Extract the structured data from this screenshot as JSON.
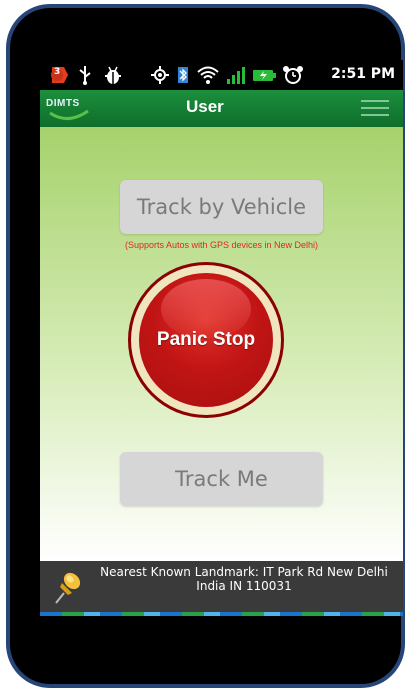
{
  "statusbar": {
    "time": "2:51 PM",
    "notification_count": "3",
    "icons": [
      "notification-badge-icon",
      "usb-icon",
      "android-debug-icon",
      "gps-icon",
      "bluetooth-icon",
      "wifi-icon",
      "signal-icon",
      "battery-icon",
      "alarm-icon"
    ]
  },
  "actionbar": {
    "logo": "DIMTS",
    "title": "User"
  },
  "main": {
    "track_vehicle_label": "Track by Vehicle",
    "support_note": "(Supports Autos with GPS devices in New Delhi)",
    "panic_label": "Panic Stop",
    "track_me_label": "Track Me"
  },
  "landmark": {
    "text": "Nearest Known Landmark: IT Park Rd New Delhi India IN 110031"
  },
  "colors": {
    "actionbar_green": "#1c8f3c",
    "content_green": "#a6d26c",
    "panic_red": "#c21515",
    "note_red": "#e0281e",
    "frame_blue": "#26467a"
  }
}
